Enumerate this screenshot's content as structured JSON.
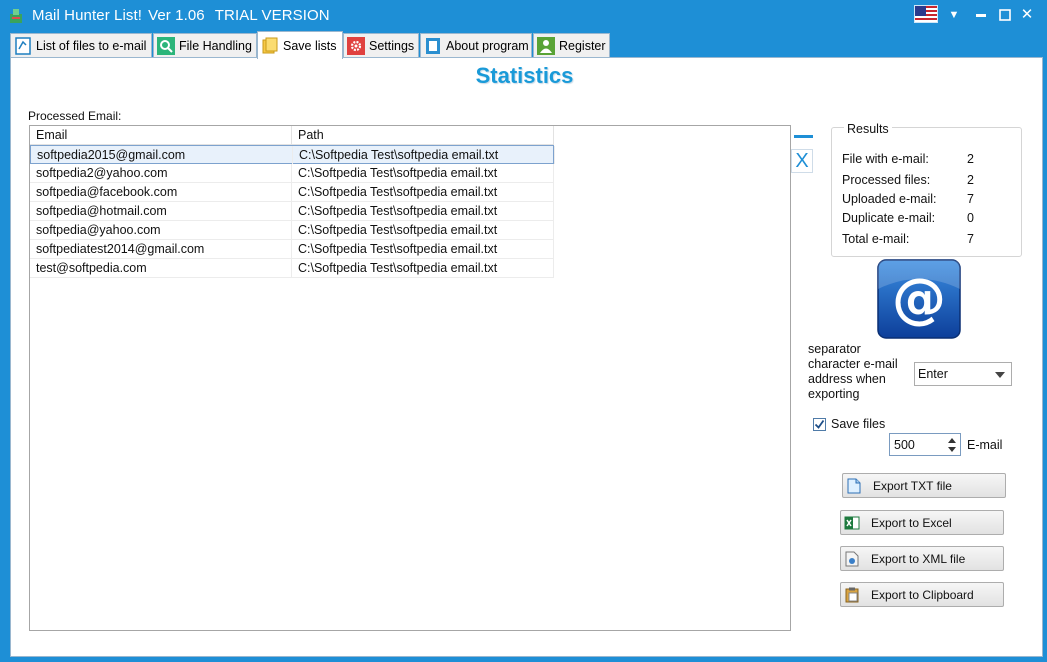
{
  "window": {
    "title_app": "Mail Hunter List!",
    "title_version": "Ver 1.06",
    "title_edition": "TRIAL VERSION",
    "minimize_glyph": "▬",
    "close_glyph": "✕",
    "menu_glyph": "▼"
  },
  "tabs": [
    {
      "label": "List of files to e-mail",
      "icon": "document-list-icon"
    },
    {
      "label": "File Handling",
      "icon": "magnifier-icon"
    },
    {
      "label": "Save lists",
      "icon": "stacked-pages-icon",
      "active": true
    },
    {
      "label": "Settings",
      "icon": "gear-icon"
    },
    {
      "label": "About program",
      "icon": "book-icon"
    },
    {
      "label": "Register",
      "icon": "person-icon"
    }
  ],
  "main": {
    "title": "Statistics",
    "processed_label": "Processed Email:",
    "columns": [
      "Email",
      "Path"
    ],
    "rows": [
      {
        "email": "softpedia2015@gmail.com",
        "path": "C:\\Softpedia Test\\softpedia email.txt"
      },
      {
        "email": "softpedia2@yahoo.com",
        "path": "C:\\Softpedia Test\\softpedia email.txt"
      },
      {
        "email": "softpedia@facebook.com",
        "path": "C:\\Softpedia Test\\softpedia email.txt"
      },
      {
        "email": "softpedia@hotmail.com",
        "path": "C:\\Softpedia Test\\softpedia email.txt"
      },
      {
        "email": "softpedia@yahoo.com",
        "path": "C:\\Softpedia Test\\softpedia email.txt"
      },
      {
        "email": "softpediatest2014@gmail.com",
        "path": "C:\\Softpedia Test\\softpedia email.txt"
      },
      {
        "email": "test@softpedia.com",
        "path": "C:\\Softpedia Test\\softpedia email.txt"
      }
    ],
    "remove_glyph": "X"
  },
  "results": {
    "legend": "Results",
    "items": [
      {
        "label": "File with e-mail:",
        "value": "2"
      },
      {
        "label": "Processed files:",
        "value": "2"
      },
      {
        "label": "Uploaded e-mail:",
        "value": "7"
      },
      {
        "label": "Duplicate e-mail:",
        "value": "0"
      },
      {
        "label": "Total e-mail:",
        "value": "7"
      }
    ]
  },
  "export": {
    "at_glyph": "@",
    "separator_label": "separator character e-mail address when exporting",
    "separator_value": "Enter",
    "save_files_label": "Save files",
    "save_files_checked": true,
    "count_value": "500",
    "count_unit": "E-mail",
    "buttons": {
      "txt": "Export TXT file",
      "excel": "Export to Excel",
      "xml": "Export to XML file",
      "clipboard": "Export to Clipboard"
    }
  },
  "colors": {
    "accent": "#1e8fd6",
    "title_blue": "#1a9ad8"
  }
}
